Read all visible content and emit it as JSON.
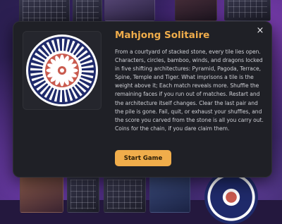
{
  "game": {
    "title": "Mahjong Solitaire",
    "description": "From a courtyard of stacked stone, every tile lies open. Characters, circles, bamboo, winds, and dragons locked in five shifting architectures: Pyramid, Pagoda, Terrace, Spine, Temple and Tiger. What imprisons a tile is the weight above it; Each match reveals more. Shuffle the remaining faces if you run out of matches. Restart and the architecture itself changes. Clear the last pair and the pile is gone. Fail, quit, or exhaust your shuffles, and the score you carved from the stone is all you carry out. Coins for the chain, if you dare claim them.",
    "start_label": "Start Game",
    "close_icon": "×"
  },
  "colors": {
    "accent": "#f0ad4b",
    "modal_bg": "#1f2026",
    "mandala_navy": "#1f2a6a",
    "mandala_red": "#c95a4e"
  }
}
